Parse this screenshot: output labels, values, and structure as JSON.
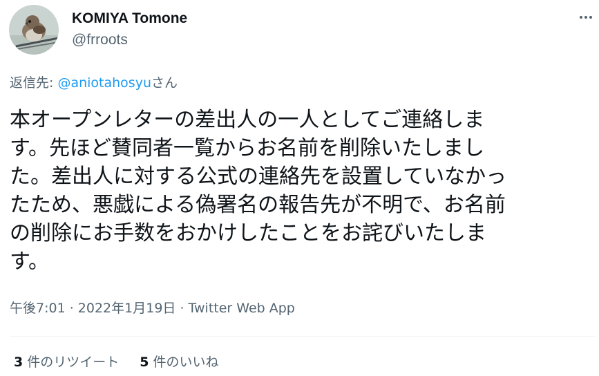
{
  "author": {
    "display_name": "KOMIYA Tomone",
    "handle": "@frroots",
    "avatar_icon": "bird-photo-avatar"
  },
  "more_icon": "more-dots-icon",
  "reply": {
    "prefix": "返信先: ",
    "mention": "@aniotahosyu",
    "suffix": "さん"
  },
  "text_lines": [
    "本オープンレターの差出人の一人としてご連絡しま",
    "す。先ほど賛同者一覧からお名前を削除いたしまし",
    "た。差出人に対する公式の連絡先を設置していなかっ",
    "たため、悪戯による偽署名の報告先が不明で、お名前",
    "の削除にお手数をおかけしたことをお詫びいたしま",
    "す。"
  ],
  "meta": {
    "time": "午後7:01",
    "separator": " · ",
    "date": "2022年1月19日",
    "source": "Twitter Web App"
  },
  "stats": {
    "retweets": {
      "count": "3",
      "label": " 件のリツイート"
    },
    "likes": {
      "count": "5",
      "label": " 件のいいね"
    }
  },
  "colors": {
    "text": "#0f1419",
    "secondary": "#536471",
    "link": "#1d9bf0",
    "divider": "#eff3f4"
  }
}
